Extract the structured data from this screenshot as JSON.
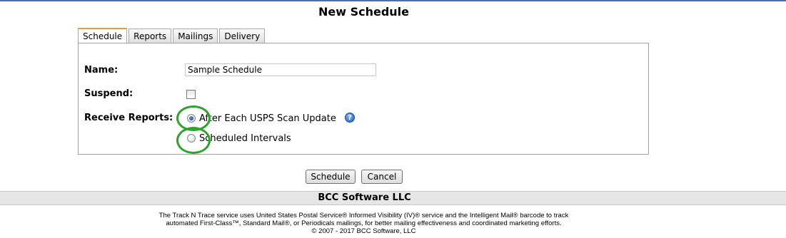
{
  "page": {
    "title": "New Schedule"
  },
  "tabs": [
    {
      "label": "Schedule",
      "active": true
    },
    {
      "label": "Reports",
      "active": false
    },
    {
      "label": "Mailings",
      "active": false
    },
    {
      "label": "Delivery",
      "active": false
    }
  ],
  "form": {
    "name_label": "Name:",
    "name_value": "Sample Schedule",
    "suspend_label": "Suspend:",
    "suspend_checked": false,
    "receive_label": "Receive Reports:",
    "options": [
      {
        "label": "After Each USPS Scan Update",
        "checked": true
      },
      {
        "label": "Scheduled Intervals",
        "checked": false
      }
    ],
    "help_icon": "question-mark-icon"
  },
  "buttons": {
    "schedule": "Schedule",
    "cancel": "Cancel"
  },
  "footer": {
    "company": "BCC Software LLC",
    "line1": "The Track N Trace service uses United States Postal Service® Informed Visibility (IV)® service and the Intelligent Mail® barcode to track",
    "line2": "automated First-Class™, Standard Mail®, or Periodicals mailings, for better mailing effectiveness and coordinated marketing efforts.",
    "line3": "© 2007 - 2017 BCC Software, LLC"
  },
  "colors": {
    "annotation_green": "#2aa52a",
    "active_tab_accent": "#e8a030",
    "top_rule": "#4a6fa5"
  }
}
